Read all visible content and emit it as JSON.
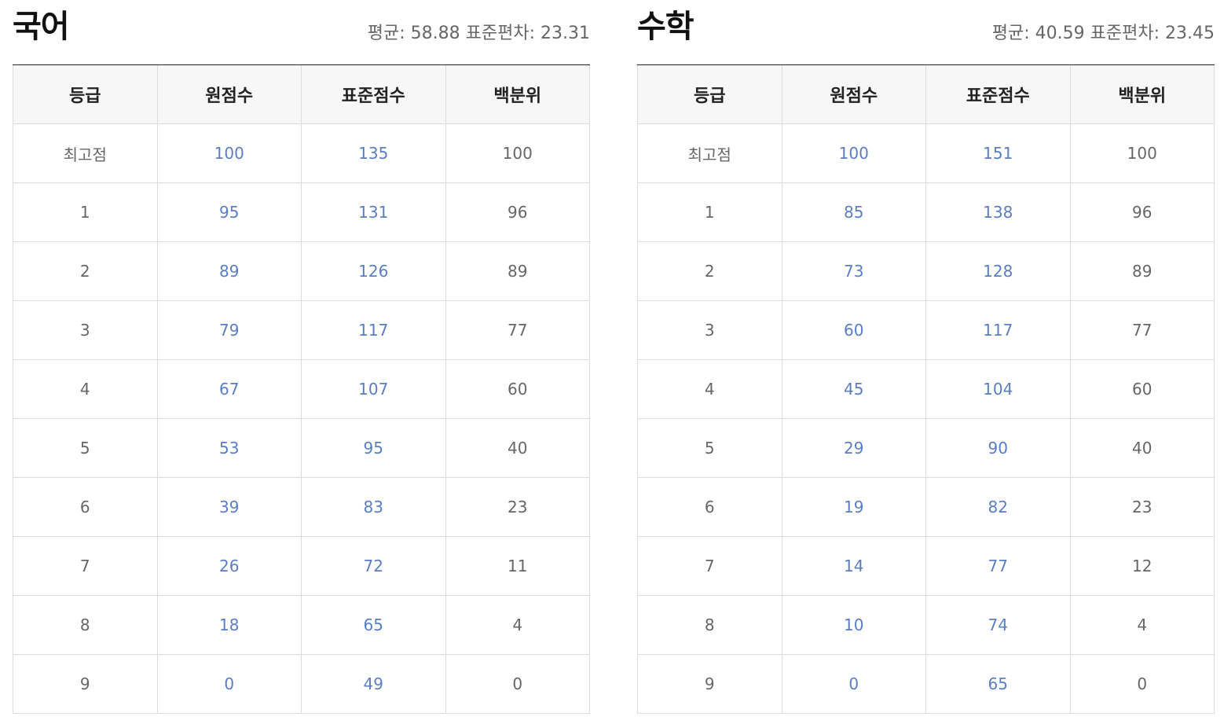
{
  "columns": [
    "등급",
    "원점수",
    "표준점수",
    "백분위"
  ],
  "subjects": [
    {
      "title": "국어",
      "mean_label": "평균: 58.88",
      "std_label": "표준편차: 23.31",
      "rows": [
        [
          "최고점",
          "100",
          "135",
          "100"
        ],
        [
          "1",
          "95",
          "131",
          "96"
        ],
        [
          "2",
          "89",
          "126",
          "89"
        ],
        [
          "3",
          "79",
          "117",
          "77"
        ],
        [
          "4",
          "67",
          "107",
          "60"
        ],
        [
          "5",
          "53",
          "95",
          "40"
        ],
        [
          "6",
          "39",
          "83",
          "23"
        ],
        [
          "7",
          "26",
          "72",
          "11"
        ],
        [
          "8",
          "18",
          "65",
          "4"
        ],
        [
          "9",
          "0",
          "49",
          "0"
        ]
      ]
    },
    {
      "title": "수학",
      "mean_label": "평균: 40.59",
      "std_label": "표준편차: 23.45",
      "rows": [
        [
          "최고점",
          "100",
          "151",
          "100"
        ],
        [
          "1",
          "85",
          "138",
          "96"
        ],
        [
          "2",
          "73",
          "128",
          "89"
        ],
        [
          "3",
          "60",
          "117",
          "77"
        ],
        [
          "4",
          "45",
          "104",
          "60"
        ],
        [
          "5",
          "29",
          "90",
          "40"
        ],
        [
          "6",
          "19",
          "82",
          "23"
        ],
        [
          "7",
          "14",
          "77",
          "12"
        ],
        [
          "8",
          "10",
          "74",
          "4"
        ],
        [
          "9",
          "0",
          "65",
          "0"
        ]
      ]
    }
  ],
  "colors": {
    "link_blue": "#5a7dc4",
    "header_bg": "#f7f7f7",
    "border": "#dddddd"
  }
}
